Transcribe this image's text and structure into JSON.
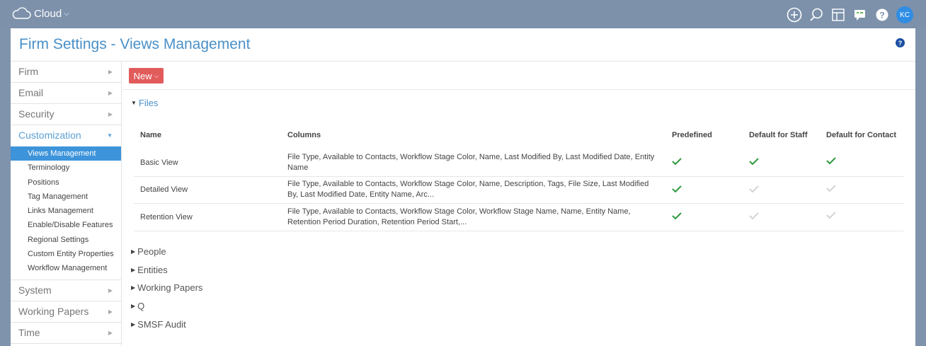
{
  "topbar": {
    "brand": "Cloud",
    "avatar_initials": "KC",
    "icons": [
      "add-circle-icon",
      "search-icon",
      "layout-icon",
      "chat-icon",
      "help-icon"
    ]
  },
  "page": {
    "title": "Firm Settings - Views Management",
    "help": "?"
  },
  "sidebar": {
    "items_top": [
      {
        "label": "Firm"
      },
      {
        "label": "Email"
      },
      {
        "label": "Security"
      }
    ],
    "active": {
      "label": "Customization"
    },
    "sub_items": [
      {
        "label": "Views Management",
        "selected": true
      },
      {
        "label": "Terminology"
      },
      {
        "label": "Positions"
      },
      {
        "label": "Tag Management"
      },
      {
        "label": "Links Management"
      },
      {
        "label": "Enable/Disable Features"
      },
      {
        "label": "Regional Settings"
      },
      {
        "label": "Custom Entity Properties"
      },
      {
        "label": "Workflow Management"
      }
    ],
    "items_bottom": [
      {
        "label": "System"
      },
      {
        "label": "Working Papers"
      },
      {
        "label": "Time"
      }
    ]
  },
  "toolbar": {
    "new_label": "New"
  },
  "sections": {
    "files": "Files",
    "collapsed": [
      "People",
      "Entities",
      "Working Papers",
      "Q",
      "SMSF Audit"
    ]
  },
  "grid": {
    "headers": {
      "name": "Name",
      "columns": "Columns",
      "predefined": "Predefined",
      "default_staff": "Default for Staff",
      "default_contact": "Default for Contact"
    },
    "rows": [
      {
        "name": "Basic View",
        "columns": "File Type, Available to Contacts, Workflow Stage Color, Name, Last Modified By, Last Modified Date, Entity Name",
        "predefined": true,
        "default_staff": true,
        "default_contact": true
      },
      {
        "name": "Detailed View",
        "columns": "File Type, Available to Contacts, Workflow Stage Color, Name, Description, Tags, File Size, Last Modified By, Last Modified Date, Entity Name, Arc...",
        "predefined": true,
        "default_staff": false,
        "default_contact": false
      },
      {
        "name": "Retention View",
        "columns": "File Type, Available to Contacts, Workflow Stage Color, Workflow Stage Name, Name, Entity Name, Retention Period Duration, Retention Period Start,...",
        "predefined": true,
        "default_staff": false,
        "default_contact": false
      }
    ]
  },
  "colors": {
    "accent": "#4a90c8",
    "new_button": "#e25b5b",
    "check_on": "#2e9a3e",
    "check_off": "#d4d4d4",
    "selected": "#3d94da"
  }
}
